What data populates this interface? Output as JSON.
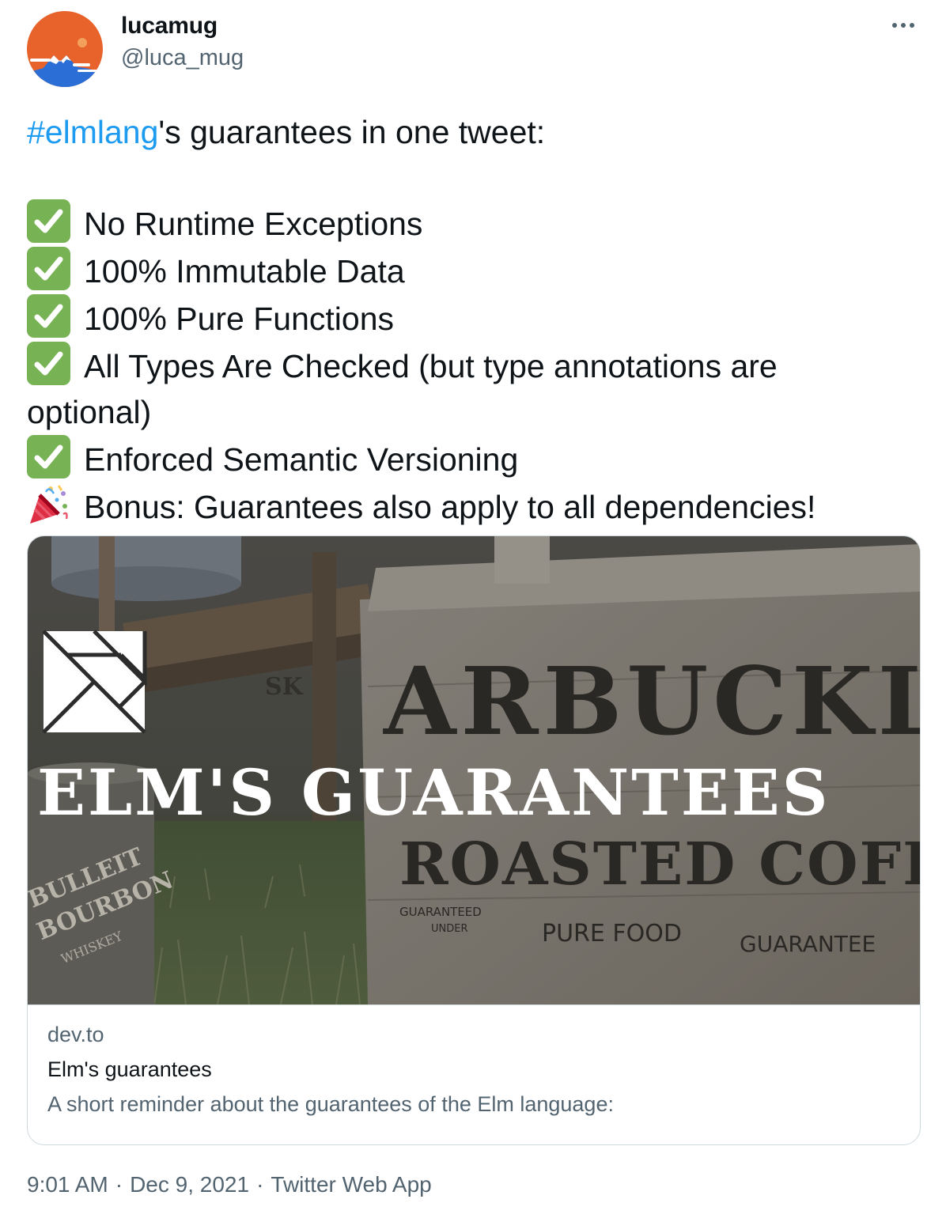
{
  "author": {
    "display_name": "lucamug",
    "handle": "@luca_mug",
    "avatar_icon": "mount-fuji-avatar",
    "avatar_bg": "#e8632c"
  },
  "more_icon": "more-horizontal-icon",
  "tweet": {
    "hashtag": "#elmlang",
    "intro_rest": "'s guarantees in one tweet:",
    "items": [
      {
        "icon": "check-mark-button-icon",
        "text": "No Runtime Exceptions"
      },
      {
        "icon": "check-mark-button-icon",
        "text": "100% Immutable Data"
      },
      {
        "icon": "check-mark-button-icon",
        "text": "100% Pure Functions"
      },
      {
        "icon": "check-mark-button-icon",
        "text": "All Types Are Checked (but type annotations are",
        "continuation": "optional)"
      },
      {
        "icon": "check-mark-button-icon",
        "text": "Enforced Semantic Versioning"
      },
      {
        "icon": "party-popper-icon",
        "text": "Bonus: Guarantees also apply to all dependencies!"
      }
    ],
    "link_color": "#1d9bf0",
    "check_color": "#77b255"
  },
  "card": {
    "domain": "dev.to",
    "title": "Elm's guarantees",
    "description": "A short reminder about the guarantees of the Elm language:",
    "image": {
      "banner_text": "ELM'S GUARANTEES",
      "crate_text_1": "ARBUCKL",
      "crate_text_2": "ROASTED COFFE",
      "crate_small_1": "GUARANTEED",
      "crate_small_2": "UNDER",
      "crate_small_3": "PURE FOOD",
      "crate_small_4": "GUARANTEE",
      "bottle_text_1": "BULLEIT",
      "bottle_text_2": "BOURBON",
      "bottle_text_3": "WHISKEY",
      "crate_side_text": "SK"
    }
  },
  "footer": {
    "time": "9:01 AM",
    "date": "Dec 9, 2021",
    "source": "Twitter Web App",
    "separator": "·"
  }
}
